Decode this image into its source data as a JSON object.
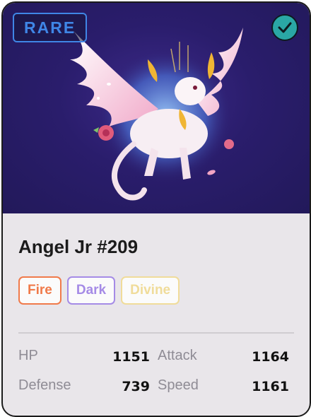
{
  "card": {
    "rarity": "RARE",
    "name": "Angel Jr #209",
    "tags": [
      {
        "label": "Fire",
        "color": "#f07a4a"
      },
      {
        "label": "Dark",
        "color": "#a58be6"
      },
      {
        "label": "Divine",
        "color": "#f0dc9a"
      }
    ],
    "stats": [
      {
        "label": "HP",
        "value": "1151"
      },
      {
        "label": "Attack",
        "value": "1164"
      },
      {
        "label": "Defense",
        "value": "739"
      },
      {
        "label": "Speed",
        "value": "1161"
      }
    ],
    "icons": {
      "badge": "check-circle-icon",
      "art": "winged-creature-illustration"
    },
    "colors": {
      "rarity": "#3f86e6",
      "check": "#2aa7a5",
      "art_bg": "#2a1d6c"
    }
  }
}
